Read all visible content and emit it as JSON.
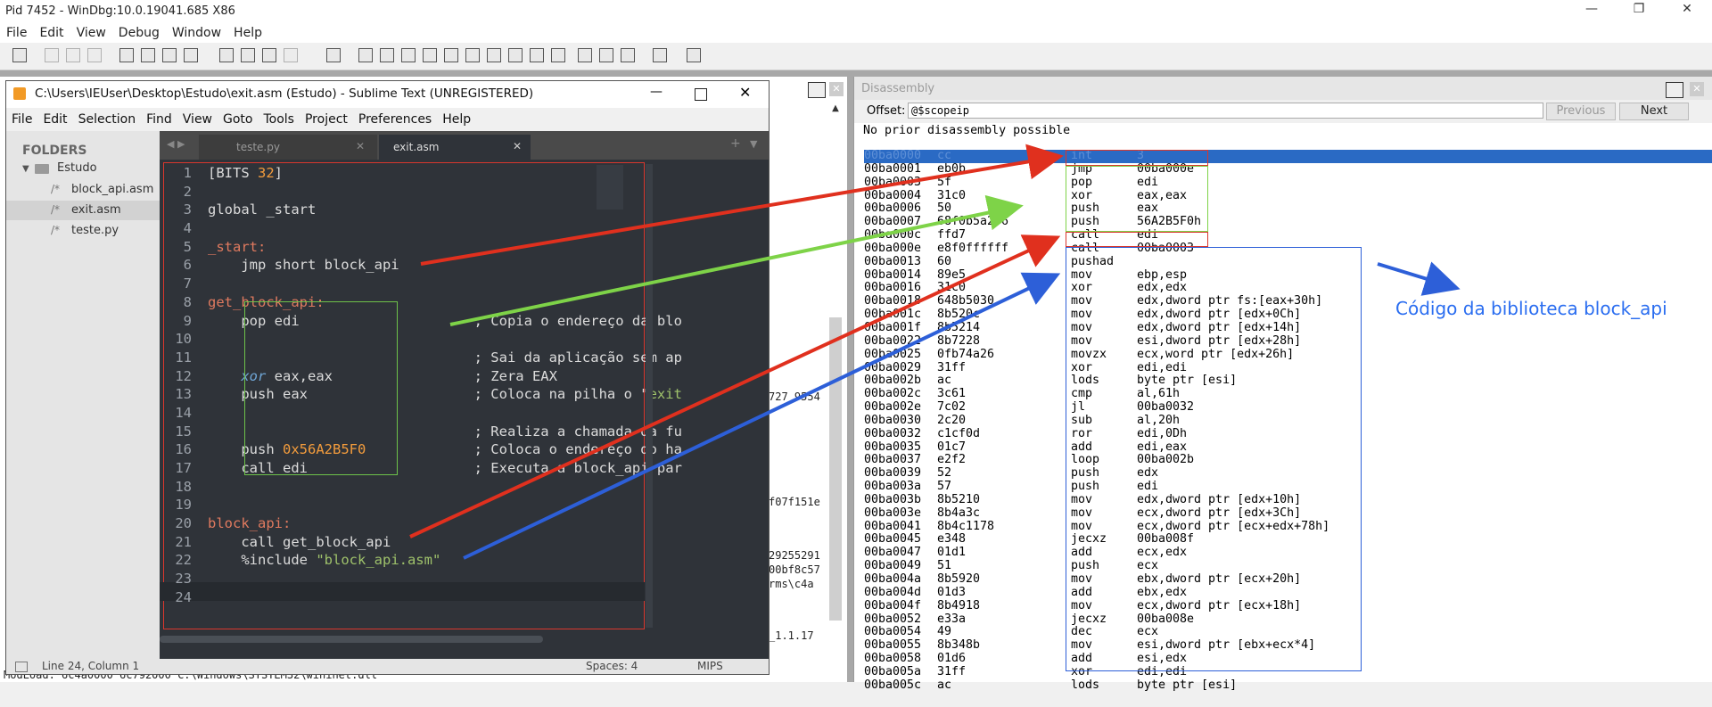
{
  "windbg": {
    "title": "Pid 7452 - WinDbg:10.0.19041.685 X86",
    "menu": [
      "File",
      "Edit",
      "View",
      "Debug",
      "Window",
      "Help"
    ],
    "background_fragments": [
      "727 9554",
      "f07f151e",
      "29255291",
      "00bf8c57",
      "rms\\c4a",
      "_1.1.17",
      "ModLoad: 6c4a0000 6c792000   C:\\Windows\\SYSTEM32\\wininet.dll"
    ]
  },
  "disassembly": {
    "title": "Disassembly",
    "offset_label": "Offset:",
    "offset_value": "@$scopeip",
    "previous_label": "Previous",
    "next_label": "Next",
    "header_line": "No prior disassembly possible",
    "rows": [
      {
        "addr": "00ba0000",
        "bytes": "cc",
        "mn": "int",
        "op": "3"
      },
      {
        "addr": "00ba0001",
        "bytes": "eb0b",
        "mn": "jmp",
        "op": "00ba000e"
      },
      {
        "addr": "00ba0003",
        "bytes": "5f",
        "mn": "pop",
        "op": "edi"
      },
      {
        "addr": "00ba0004",
        "bytes": "31c0",
        "mn": "xor",
        "op": "eax,eax"
      },
      {
        "addr": "00ba0006",
        "bytes": "50",
        "mn": "push",
        "op": "eax"
      },
      {
        "addr": "00ba0007",
        "bytes": "68f0b5a256",
        "mn": "push",
        "op": "56A2B5F0h"
      },
      {
        "addr": "00ba000c",
        "bytes": "ffd7",
        "mn": "call",
        "op": "edi"
      },
      {
        "addr": "00ba000e",
        "bytes": "e8f0ffffff",
        "mn": "call",
        "op": "00ba0003"
      },
      {
        "addr": "00ba0013",
        "bytes": "60",
        "mn": "pushad",
        "op": ""
      },
      {
        "addr": "00ba0014",
        "bytes": "89e5",
        "mn": "mov",
        "op": "ebp,esp"
      },
      {
        "addr": "00ba0016",
        "bytes": "31c0",
        "mn": "xor",
        "op": "edx,edx"
      },
      {
        "addr": "00ba0018",
        "bytes": "648b5030",
        "mn": "mov",
        "op": "edx,dword ptr fs:[eax+30h]"
      },
      {
        "addr": "00ba001c",
        "bytes": "8b520c",
        "mn": "mov",
        "op": "edx,dword ptr [edx+0Ch]"
      },
      {
        "addr": "00ba001f",
        "bytes": "8b5214",
        "mn": "mov",
        "op": "edx,dword ptr [edx+14h]"
      },
      {
        "addr": "00ba0022",
        "bytes": "8b7228",
        "mn": "mov",
        "op": "esi,dword ptr [edx+28h]"
      },
      {
        "addr": "00ba0025",
        "bytes": "0fb74a26",
        "mn": "movzx",
        "op": "ecx,word ptr [edx+26h]"
      },
      {
        "addr": "00ba0029",
        "bytes": "31ff",
        "mn": "xor",
        "op": "edi,edi"
      },
      {
        "addr": "00ba002b",
        "bytes": "ac",
        "mn": "lods",
        "op": "byte ptr [esi]"
      },
      {
        "addr": "00ba002c",
        "bytes": "3c61",
        "mn": "cmp",
        "op": "al,61h"
      },
      {
        "addr": "00ba002e",
        "bytes": "7c02",
        "mn": "jl",
        "op": "00ba0032"
      },
      {
        "addr": "00ba0030",
        "bytes": "2c20",
        "mn": "sub",
        "op": "al,20h"
      },
      {
        "addr": "00ba0032",
        "bytes": "c1cf0d",
        "mn": "ror",
        "op": "edi,0Dh"
      },
      {
        "addr": "00ba0035",
        "bytes": "01c7",
        "mn": "add",
        "op": "edi,eax"
      },
      {
        "addr": "00ba0037",
        "bytes": "e2f2",
        "mn": "loop",
        "op": "00ba002b"
      },
      {
        "addr": "00ba0039",
        "bytes": "52",
        "mn": "push",
        "op": "edx"
      },
      {
        "addr": "00ba003a",
        "bytes": "57",
        "mn": "push",
        "op": "edi"
      },
      {
        "addr": "00ba003b",
        "bytes": "8b5210",
        "mn": "mov",
        "op": "edx,dword ptr [edx+10h]"
      },
      {
        "addr": "00ba003e",
        "bytes": "8b4a3c",
        "mn": "mov",
        "op": "ecx,dword ptr [edx+3Ch]"
      },
      {
        "addr": "00ba0041",
        "bytes": "8b4c1178",
        "mn": "mov",
        "op": "ecx,dword ptr [ecx+edx+78h]"
      },
      {
        "addr": "00ba0045",
        "bytes": "e348",
        "mn": "jecxz",
        "op": "00ba008f"
      },
      {
        "addr": "00ba0047",
        "bytes": "01d1",
        "mn": "add",
        "op": "ecx,edx"
      },
      {
        "addr": "00ba0049",
        "bytes": "51",
        "mn": "push",
        "op": "ecx"
      },
      {
        "addr": "00ba004a",
        "bytes": "8b5920",
        "mn": "mov",
        "op": "ebx,dword ptr [ecx+20h]"
      },
      {
        "addr": "00ba004d",
        "bytes": "01d3",
        "mn": "add",
        "op": "ebx,edx"
      },
      {
        "addr": "00ba004f",
        "bytes": "8b4918",
        "mn": "mov",
        "op": "ecx,dword ptr [ecx+18h]"
      },
      {
        "addr": "00ba0052",
        "bytes": "e33a",
        "mn": "jecxz",
        "op": "00ba008e"
      },
      {
        "addr": "00ba0054",
        "bytes": "49",
        "mn": "dec",
        "op": "ecx"
      },
      {
        "addr": "00ba0055",
        "bytes": "8b348b",
        "mn": "mov",
        "op": "esi,dword ptr [ebx+ecx*4]"
      },
      {
        "addr": "00ba0058",
        "bytes": "01d6",
        "mn": "add",
        "op": "esi,edx"
      },
      {
        "addr": "00ba005a",
        "bytes": "31ff",
        "mn": "xor",
        "op": "edi,edi"
      },
      {
        "addr": "00ba005c",
        "bytes": "ac",
        "mn": "lods",
        "op": "byte ptr [esi]"
      }
    ]
  },
  "annotation": "Código da biblioteca block_api",
  "sublime": {
    "title": "C:\\Users\\IEUser\\Desktop\\Estudo\\exit.asm (Estudo) - Sublime Text (UNREGISTERED)",
    "menu": [
      "File",
      "Edit",
      "Selection",
      "Find",
      "View",
      "Goto",
      "Tools",
      "Project",
      "Preferences",
      "Help"
    ],
    "folders_label": "FOLDERS",
    "root_folder": "Estudo",
    "files": [
      "block_api.asm",
      "exit.asm",
      "teste.py"
    ],
    "tabs": [
      "teste.py",
      "exit.asm"
    ],
    "status_left": "Line 24, Column 1",
    "status_spaces": "Spaces: 4",
    "status_syntax": "MIPS",
    "lines": [
      {
        "n": "1",
        "parts": [
          [
            "c-txt",
            "[BITS "
          ],
          [
            "c-num",
            "32"
          ],
          [
            "c-txt",
            "]"
          ]
        ]
      },
      {
        "n": "2",
        "parts": []
      },
      {
        "n": "3",
        "parts": [
          [
            "c-txt",
            "global _start"
          ]
        ]
      },
      {
        "n": "4",
        "parts": []
      },
      {
        "n": "5",
        "parts": [
          [
            "kw-lbl",
            "_start:"
          ]
        ]
      },
      {
        "n": "6",
        "parts": [
          [
            "c-txt",
            "    jmp short block_api"
          ]
        ]
      },
      {
        "n": "7",
        "parts": []
      },
      {
        "n": "8",
        "parts": [
          [
            "kw-lbl",
            "get_block_api:"
          ]
        ]
      },
      {
        "n": "9",
        "parts": [
          [
            "c-txt",
            "    pop edi                     ; Copia o endereço da blo"
          ]
        ]
      },
      {
        "n": "10",
        "parts": []
      },
      {
        "n": "11",
        "parts": [
          [
            "c-txt",
            "                                ; Sai da aplicação sem ap"
          ]
        ]
      },
      {
        "n": "12",
        "parts": [
          [
            "c-txt",
            "    "
          ],
          [
            "c-it",
            "xor"
          ],
          [
            "c-txt",
            " eax,eax                 ; Zera EAX"
          ]
        ]
      },
      {
        "n": "13",
        "parts": [
          [
            "c-txt",
            "    push eax                    ; Coloca na pilha o \""
          ],
          [
            "c-str",
            "exit"
          ]
        ]
      },
      {
        "n": "14",
        "parts": []
      },
      {
        "n": "15",
        "parts": [
          [
            "c-txt",
            "                                ; Realiza a chamada da fu"
          ]
        ]
      },
      {
        "n": "16",
        "parts": [
          [
            "c-txt",
            "    push "
          ],
          [
            "c-num",
            "0x56A2B5F0"
          ],
          [
            "c-txt",
            "             ; Coloca o endereço do ha"
          ]
        ]
      },
      {
        "n": "17",
        "parts": [
          [
            "c-txt",
            "    call edi                    ; Executa a block_api par"
          ]
        ]
      },
      {
        "n": "18",
        "parts": []
      },
      {
        "n": "19",
        "parts": []
      },
      {
        "n": "20",
        "parts": [
          [
            "kw-lbl",
            "block_api:"
          ]
        ]
      },
      {
        "n": "21",
        "parts": [
          [
            "c-txt",
            "    call get_block_api"
          ]
        ]
      },
      {
        "n": "22",
        "parts": [
          [
            "c-txt",
            "    %include "
          ],
          [
            "c-str",
            "\"block_api.asm\""
          ]
        ]
      },
      {
        "n": "23",
        "parts": []
      },
      {
        "n": "24",
        "parts": []
      }
    ]
  },
  "colors": {
    "red": "#e0301e",
    "green": "#7ed348",
    "blue": "#2d5fd8",
    "annotation": "#2a6df0"
  }
}
